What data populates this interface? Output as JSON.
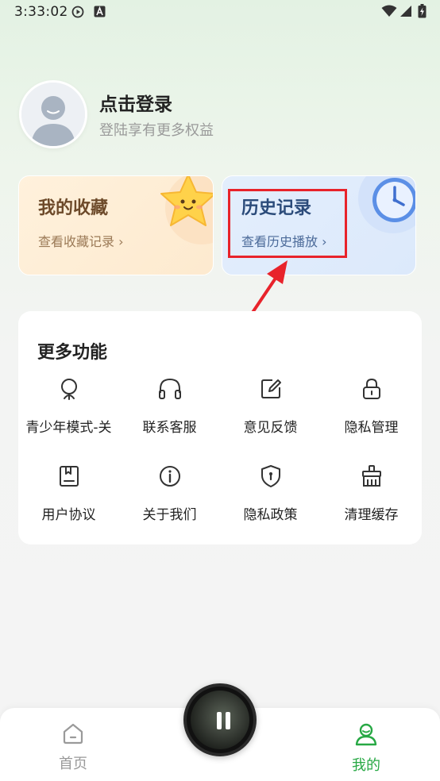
{
  "status_bar": {
    "time": "3:33:02"
  },
  "profile": {
    "title": "点击登录",
    "subtitle": "登陆享有更多权益"
  },
  "favorites_card": {
    "title": "我的收藏",
    "link": "查看收藏记录 ›"
  },
  "history_card": {
    "title": "历史记录",
    "link": "查看历史播放 ›"
  },
  "more_functions": {
    "title": "更多功能",
    "items": [
      {
        "label": "青少年模式-关",
        "icon": "youth-mode-icon"
      },
      {
        "label": "联系客服",
        "icon": "headset-icon"
      },
      {
        "label": "意见反馈",
        "icon": "feedback-icon"
      },
      {
        "label": "隐私管理",
        "icon": "lock-icon"
      },
      {
        "label": "用户协议",
        "icon": "agreement-icon"
      },
      {
        "label": "关于我们",
        "icon": "info-icon"
      },
      {
        "label": "隐私政策",
        "icon": "shield-icon"
      },
      {
        "label": "清理缓存",
        "icon": "broom-icon"
      }
    ]
  },
  "tab_bar": {
    "home_label": "首页",
    "mine_label": "我的"
  },
  "colors": {
    "accent_green": "#27a844",
    "highlight_red": "#e8232b"
  }
}
